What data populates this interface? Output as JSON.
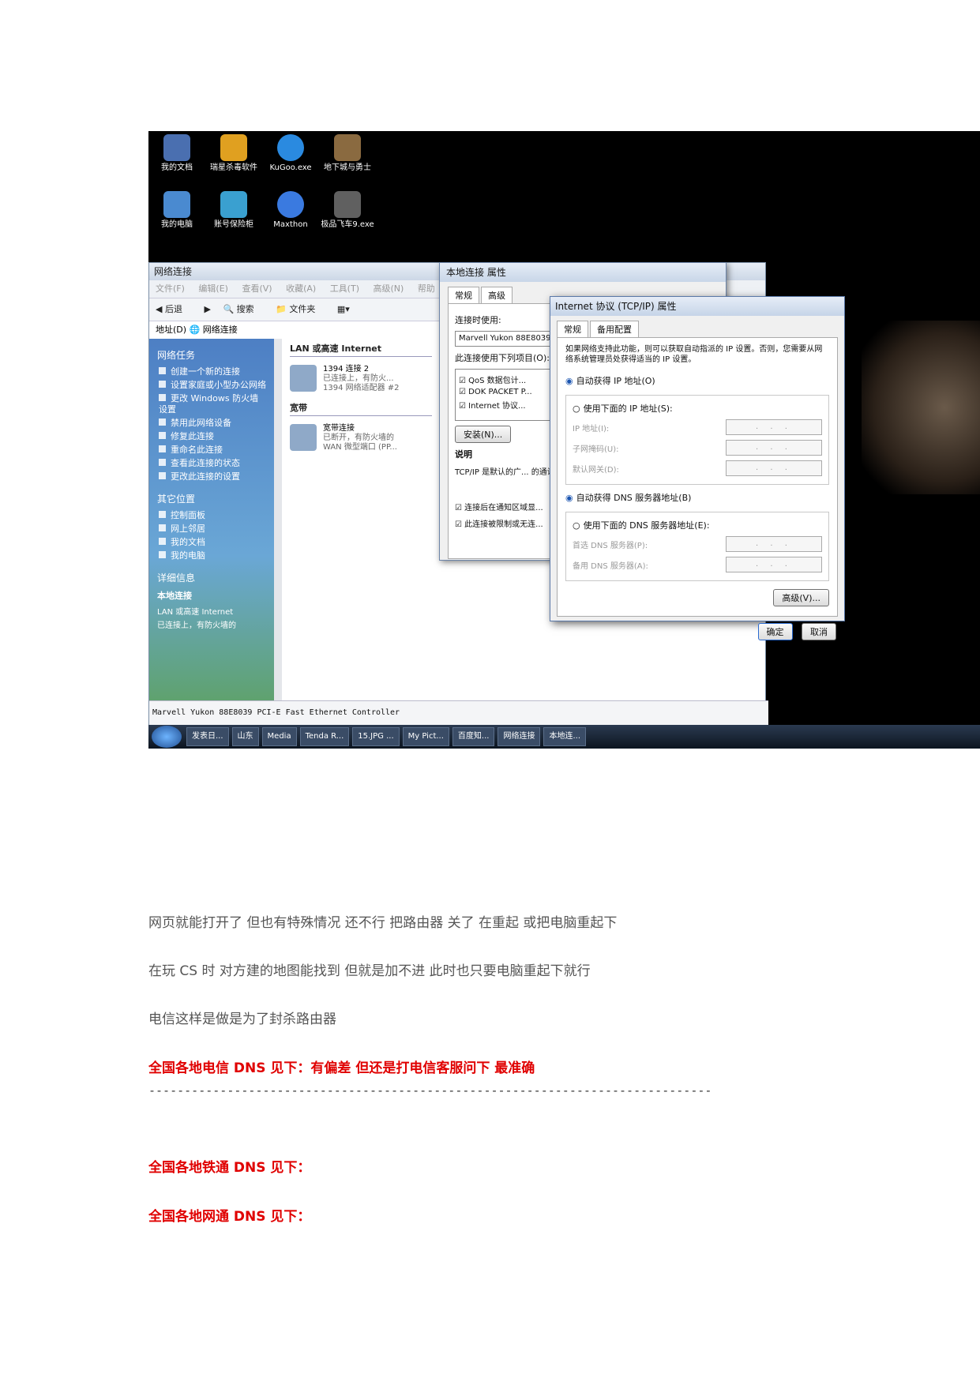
{
  "desktop_icons": [
    {
      "label": "我的文档",
      "color": "#4a6fb0"
    },
    {
      "label": "瑞星杀毒软件",
      "color": "#e0a020"
    },
    {
      "label": "KuGoo.exe",
      "color": "#2a8ae0"
    },
    {
      "label": "地下城与勇士",
      "color": "#8a6a40"
    },
    {
      "label": "我的电脑",
      "color": "#4a8ad0"
    },
    {
      "label": "账号保险柜",
      "color": "#3aa0d0"
    },
    {
      "label": "Maxthon",
      "color": "#3a7ae0"
    },
    {
      "label": "极品飞车9.exe",
      "color": "#606060"
    }
  ],
  "explorer": {
    "title": "网络连接",
    "menu": [
      "文件(F)",
      "编辑(E)",
      "查看(V)",
      "收藏(A)",
      "工具(T)",
      "高级(N)",
      "帮助"
    ],
    "toolbar": [
      "后退",
      "搜索",
      "文件夹"
    ],
    "address_label": "地址(D)",
    "address_value": "网络连接",
    "tasks_header": "网络任务",
    "tasks": [
      "创建一个新的连接",
      "设置家庭或小型办公网络",
      "更改 Windows 防火墙设置",
      "禁用此网络设备",
      "修复此连接",
      "重命名此连接",
      "查看此连接的状态",
      "更改此连接的设置"
    ],
    "other_header": "其它位置",
    "other": [
      "控制面板",
      "网上邻居",
      "我的文档",
      "我的电脑"
    ],
    "details_header": "详细信息",
    "details_title": "本地连接",
    "details_lines": [
      "LAN 或高速 Internet",
      "已连接上，有防火墙的"
    ],
    "group_lan": "LAN 或高速 Internet",
    "conn1_name": "1394 连接 2",
    "conn1_status": "已连接上，有防火...",
    "conn1_device": "1394 网络适配器 #2",
    "group_broadband": "宽带",
    "conn2_name": "宽带连接",
    "conn2_status": "已断开，有防火墙的",
    "conn2_device": "WAN 微型端口 (PP...",
    "status_bar": "Marvell Yukon 88E8039 PCI-E Fast Ethernet Controller"
  },
  "props": {
    "title": "本地连接 属性",
    "tab1": "常规",
    "tab2": "高级",
    "connect_using": "连接时使用:",
    "adapter": "Marvell Yukon 88E8039 PCI-E F...",
    "items_label": "此连接使用下列项目(O):",
    "items": [
      "☑ QoS 数据包计...",
      "☑ DOK PACKET P...",
      "☑ Internet 协议..."
    ],
    "install": "安装(N)...",
    "desc_label": "说明",
    "desc": "TCP/IP 是默认的广... 的通讯。",
    "check1": "☑ 连接后在通知区域显...",
    "check2": "☑ 此连接被限制或无连..."
  },
  "tcp": {
    "title": "Internet 协议 (TCP/IP) 属性",
    "tab1": "常规",
    "tab2": "备用配置",
    "desc": "如果网络支持此功能，则可以获取自动指派的 IP 设置。否则，您需要从网络系统管理员处获得适当的 IP 设置。",
    "auto_ip": "自动获得 IP 地址(O)",
    "manual_ip": "使用下面的 IP 地址(S):",
    "ip": "IP 地址(I):",
    "mask": "子网掩码(U):",
    "gateway": "默认网关(D):",
    "auto_dns": "自动获得 DNS 服务器地址(B)",
    "manual_dns": "使用下面的 DNS 服务器地址(E):",
    "dns1": "首选 DNS 服务器(P):",
    "dns2": "备用 DNS 服务器(A):",
    "ip_placeholder": ". . .",
    "advanced": "高级(V)...",
    "ok": "确定",
    "cancel": "取消"
  },
  "taskbar": [
    "发表日...",
    "山东",
    "Media",
    "Tenda R...",
    "15.JPG ...",
    "My Pict...",
    "百度知...",
    "网络连接",
    "本地连..."
  ],
  "text": {
    "line1": "网页就能打开了 但也有特殊情况 还不行  把路由器 关了 在重起 或把电脑重起下",
    "line2": "在玩 CS 时 对方建的地图能找到 但就是加不进 此时也只要电脑重起下就行",
    "line3": " 电信这样是做是为了封杀路由器",
    "line4": "全国各地电信 DNS 见下：有偏差  但还是打电信客服问下 最准确",
    "dashes": "-------------------------------------------------------------------------------",
    "line5": "全国各地铁通 DNS 见下：",
    "line6": "全国各地网通 DNS 见下："
  }
}
